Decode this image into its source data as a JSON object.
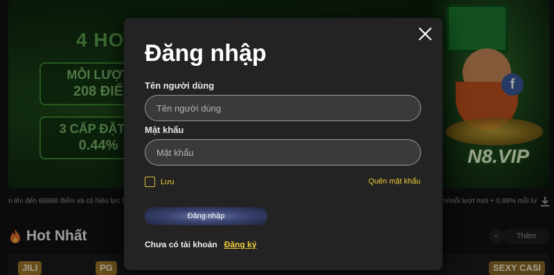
{
  "background": {
    "promo_title": "4 HO",
    "promo_box_1": {
      "line1": "MỖI LƯỢT",
      "line2": "208 ĐIỂ"
    },
    "promo_box_2": {
      "line1": "3 CẤP ĐẶT C",
      "line2": "0.44%"
    },
    "vip_text": "N8.VIP",
    "facebook_badge": "f",
    "ticker_left": "n lên đến 68888 điểm và có hiệu lực trọ",
    "ticker_right": "m/mỗi lượt mới + 0.88% mỗi lư",
    "hot_title": "Hot Nhất",
    "more_label": "Thêm",
    "prev_label": "<",
    "game_tags": [
      "JILI",
      "PG",
      "SEXY CASI"
    ]
  },
  "modal": {
    "title": "Đăng nhập",
    "username_label": "Tên người dùng",
    "username_placeholder": "Tên người dùng",
    "username_value": "",
    "password_label": "Mật khẩu",
    "password_placeholder": "Mật khẩu",
    "password_value": "",
    "remember_label": "Lưu",
    "forgot_label": "Quên mật khẩu",
    "login_label": "Đăng nhập",
    "no_account_text": "Chưa có tài khoản",
    "signup_label": "Đăng ký"
  },
  "colors": {
    "accent_yellow": "#f0cf3a",
    "modal_bg": "#232323",
    "input_bg": "#3a3a3a"
  },
  "icons": {
    "close": "close-icon",
    "hot": "fire-icon",
    "download": "download-icon"
  }
}
